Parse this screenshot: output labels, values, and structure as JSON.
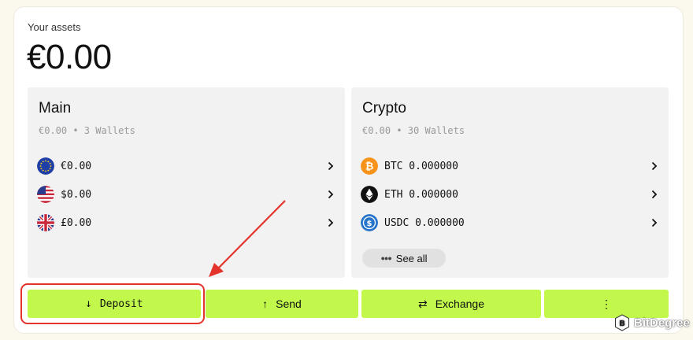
{
  "header": {
    "label": "Your assets",
    "balance": "€0.00"
  },
  "main_panel": {
    "title": "Main",
    "subtitle": "€0.00 • 3 Wallets",
    "rows": [
      {
        "icon": "eu-flag-icon",
        "amount": "€0.00"
      },
      {
        "icon": "us-flag-icon",
        "amount": "$0.00"
      },
      {
        "icon": "uk-flag-icon",
        "amount": "£0.00"
      }
    ]
  },
  "crypto_panel": {
    "title": "Crypto",
    "subtitle": "€0.00 • 30 Wallets",
    "rows": [
      {
        "icon": "bitcoin-icon",
        "amount": "BTC 0.000000"
      },
      {
        "icon": "ethereum-icon",
        "amount": "ETH 0.000000"
      },
      {
        "icon": "usdc-icon",
        "amount": "USDC 0.000000"
      }
    ],
    "see_all": "See all"
  },
  "actions": {
    "deposit": "Deposit",
    "send": "Send",
    "exchange": "Exchange",
    "more": "⋮"
  },
  "watermark": "BitDegree",
  "colors": {
    "accent": "#c1f84b",
    "highlight": "#e3332b",
    "panel": "#f2f2f2"
  }
}
